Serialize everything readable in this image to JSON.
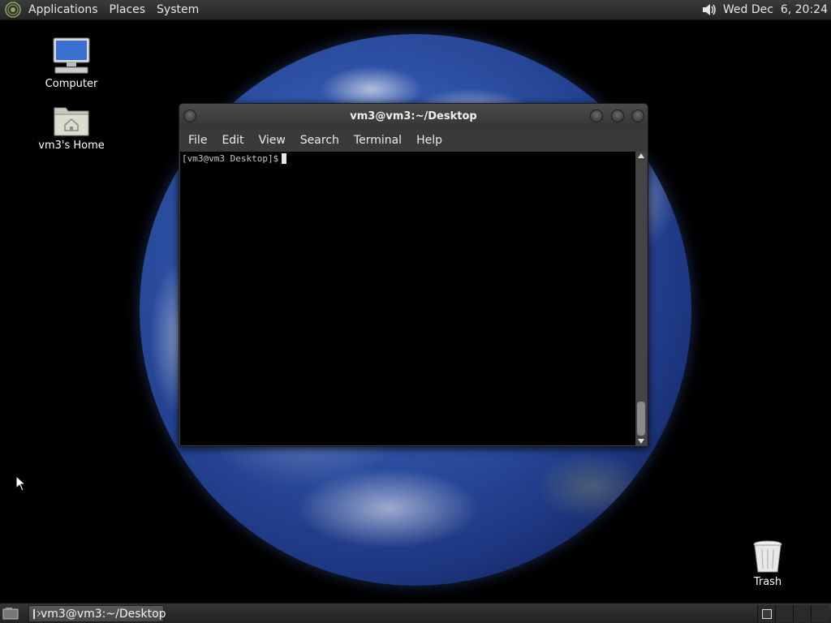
{
  "top_panel": {
    "menus": [
      "Applications",
      "Places",
      "System"
    ],
    "clock": "Wed Dec  6, 20:24",
    "icons": {
      "logo": "gnome-foot-icon",
      "volume": "speaker-icon"
    }
  },
  "desktop": {
    "icons": [
      {
        "label": "Computer",
        "icon": "computer-icon"
      },
      {
        "label": "vm3's Home",
        "icon": "home-folder-icon"
      },
      {
        "label": "Trash",
        "icon": "trash-icon"
      }
    ],
    "wallpaper": "earth"
  },
  "terminal": {
    "title": "vm3@vm3:~/Desktop",
    "menu": [
      "File",
      "Edit",
      "View",
      "Search",
      "Terminal",
      "Help"
    ],
    "prompt": "[vm3@vm3 Desktop]$"
  },
  "bottom_panel": {
    "task_label": "vm3@vm3:~/Desktop",
    "workspaces": 4,
    "active_workspace": 1
  },
  "colors": {
    "panel": "#2e2e2e",
    "window": "#3c3c3c",
    "terminal_bg": "#000000",
    "terminal_fg": "#c8c8c8"
  }
}
